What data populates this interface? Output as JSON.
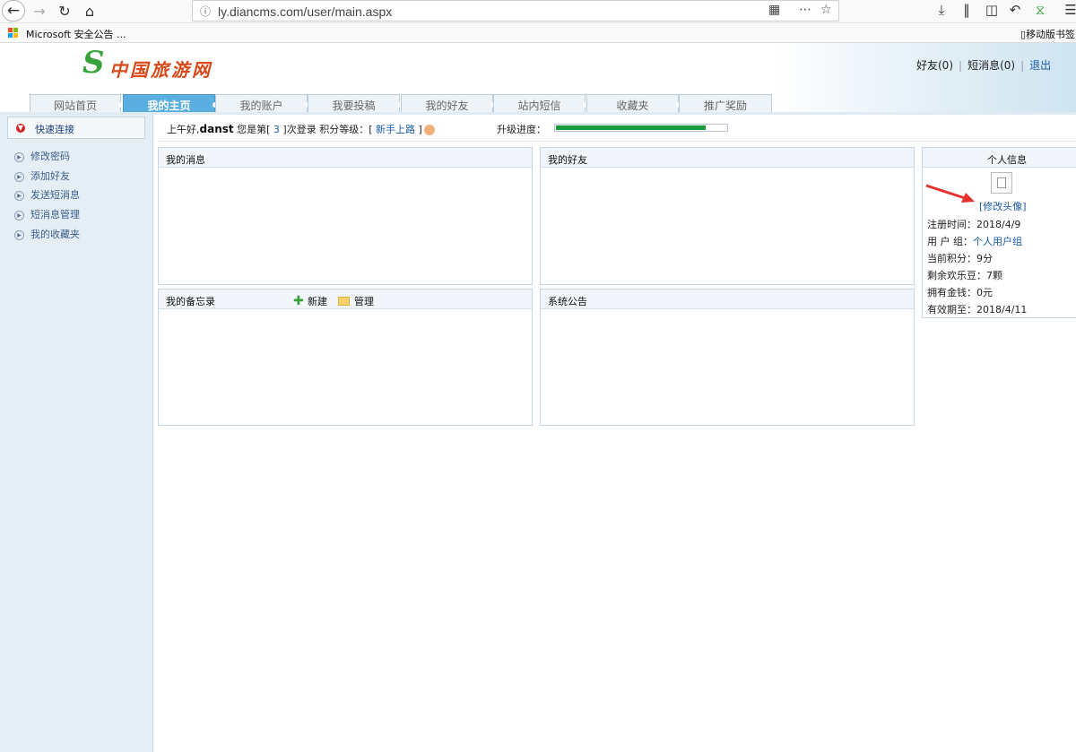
{
  "browser": {
    "url": "ly.diancms.com/user/main.aspx",
    "bookmark": "Microsoft 安全公告 ...",
    "mobile_bookmark": "移动版书签",
    "icons": [
      "back-icon",
      "forward-icon",
      "reload-icon",
      "home-icon",
      "info-icon",
      "qr-code-icon",
      "more-icon",
      "star-icon",
      "download-icon",
      "library-icon",
      "sidebar-icon",
      "undo-icon",
      "extension-icon",
      "menu-icon"
    ]
  },
  "site": {
    "logo_text": "中国旅游网",
    "top_links": {
      "friends": "好友(0)",
      "messages": "短消息(0)",
      "logout": "退出"
    }
  },
  "tabs": [
    {
      "label": "网站首页",
      "active": false
    },
    {
      "label": "我的主页",
      "active": true
    },
    {
      "label": "我的账户",
      "active": false
    },
    {
      "label": "我要投稿",
      "active": false
    },
    {
      "label": "我的好友",
      "active": false
    },
    {
      "label": "站内短信",
      "active": false
    },
    {
      "label": "收藏夹",
      "active": false
    },
    {
      "label": "推广奖励",
      "active": false
    }
  ],
  "sidebar": {
    "quick_link": "快速连接",
    "items": [
      "修改密码",
      "添加好友",
      "发送短消息",
      "短消息管理",
      "我的收藏夹"
    ]
  },
  "welcome": {
    "greeting": "上午好,",
    "username": "danst",
    "login_prefix": " 您是第[ ",
    "login_count": "3",
    "login_suffix": " ]次登录  积分等级：[ ",
    "level": "新手上路",
    "level_suffix": " ]",
    "upgrade_label": "升级进度：",
    "progress": 0.88
  },
  "panels": {
    "messages": "我的消息",
    "friends": "我的好友",
    "memo": "我的备忘录",
    "memo_new": "新建",
    "memo_manage": "管理",
    "announcements": "系统公告"
  },
  "profile": {
    "title": "个人信息",
    "edit_avatar": "[修改头像]",
    "reg_time_label": "注册时间：",
    "reg_time": "2018/4/9",
    "group_label": "用 户 组：",
    "group": "个人用户组",
    "points_label": "当前积分：",
    "points": "9分",
    "beans_label": "剩余欢乐豆：",
    "beans": "7颗",
    "money_label": "拥有金钱：",
    "money": "0元",
    "expire_label": "有效期至：",
    "expire": "2018/4/11"
  },
  "colors": {
    "accent": "#5aaee0",
    "link": "#1a5aa8",
    "progress": "#1a9a3a",
    "annotation_arrow": "#e53030"
  }
}
